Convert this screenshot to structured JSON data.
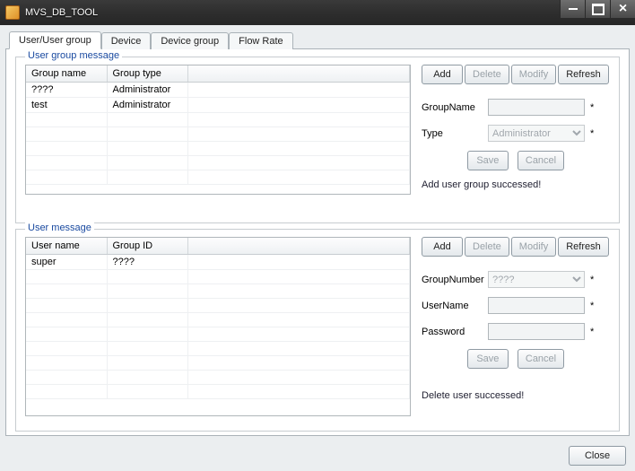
{
  "window": {
    "title": "MVS_DB_TOOL"
  },
  "tabs": [
    {
      "label": "User/User group",
      "active": true
    },
    {
      "label": "Device",
      "active": false
    },
    {
      "label": "Device group",
      "active": false
    },
    {
      "label": "Flow Rate",
      "active": false
    }
  ],
  "group1": {
    "legend": "User group message",
    "columns": [
      "Group name",
      "Group type"
    ],
    "rows": [
      {
        "c0": "????",
        "c1": "Administrator"
      },
      {
        "c0": "test",
        "c1": "Administrator"
      }
    ],
    "buttons": {
      "add": "Add",
      "del": "Delete",
      "mod": "Modify",
      "refresh": "Refresh",
      "save": "Save",
      "cancel": "Cancel"
    },
    "labels": {
      "groupname": "GroupName",
      "type": "Type"
    },
    "values": {
      "groupname": "",
      "type": "Administrator"
    },
    "asterisk": "*",
    "status": "Add user group successed!"
  },
  "group2": {
    "legend": "User message",
    "columns": [
      "User name",
      "Group ID"
    ],
    "rows": [
      {
        "c0": "super",
        "c1": "????"
      }
    ],
    "buttons": {
      "add": "Add",
      "del": "Delete",
      "mod": "Modify",
      "refresh": "Refresh",
      "save": "Save",
      "cancel": "Cancel"
    },
    "labels": {
      "groupnumber": "GroupNumber",
      "username": "UserName",
      "password": "Password"
    },
    "values": {
      "groupnumber": "????",
      "username": "",
      "password": ""
    },
    "asterisk": "*",
    "status": "Delete user successed!"
  },
  "footer": {
    "close": "Close"
  }
}
